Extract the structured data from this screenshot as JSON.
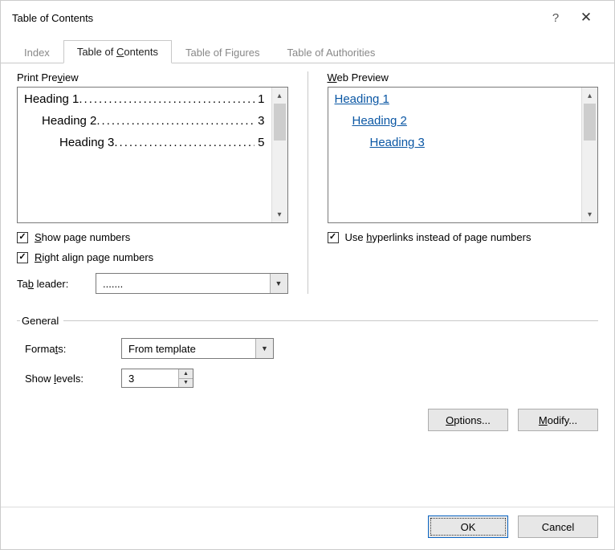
{
  "title": "Table of Contents",
  "tabs": {
    "index": "Index",
    "toc_prefix": "Table of ",
    "toc_u": "C",
    "toc_suffix": "ontents",
    "tof": "Table of Figures",
    "toa": "Table of Authorities"
  },
  "print_preview": {
    "label_prefix": "Print Pre",
    "label_u": "v",
    "label_suffix": "iew",
    "rows": [
      {
        "text": "Heading 1",
        "page": "1",
        "indent": 0
      },
      {
        "text": "Heading 2",
        "page": "3",
        "indent": 1
      },
      {
        "text": "Heading 3",
        "page": "5",
        "indent": 2
      }
    ],
    "leader_glyph": "............................................."
  },
  "web_preview": {
    "label_u": "W",
    "label_suffix": "eb Preview",
    "links": [
      {
        "text": "Heading 1",
        "indent": 0
      },
      {
        "text": "Heading 2",
        "indent": 1
      },
      {
        "text": "Heading 3",
        "indent": 2
      }
    ]
  },
  "checkboxes": {
    "show_pn_u": "S",
    "show_pn_suffix": "how page numbers",
    "right_align_u": "R",
    "right_align_suffix": "ight align page numbers",
    "hyperlinks_prefix": "Use ",
    "hyperlinks_u": "h",
    "hyperlinks_suffix": "yperlinks instead of page numbers"
  },
  "tab_leader": {
    "label_prefix": "Ta",
    "label_u": "b",
    "label_suffix": " leader:",
    "value": "......."
  },
  "general": {
    "legend": "General",
    "formats_label_prefix": "Forma",
    "formats_label_u": "t",
    "formats_label_suffix": "s:",
    "formats_value": "From template",
    "levels_label_prefix": "Show ",
    "levels_label_u": "l",
    "levels_label_suffix": "evels:",
    "levels_value": "3"
  },
  "buttons": {
    "options_u": "O",
    "options_suffix": "ptions...",
    "modify_u": "M",
    "modify_suffix": "odify...",
    "ok": "OK",
    "cancel": "Cancel"
  }
}
